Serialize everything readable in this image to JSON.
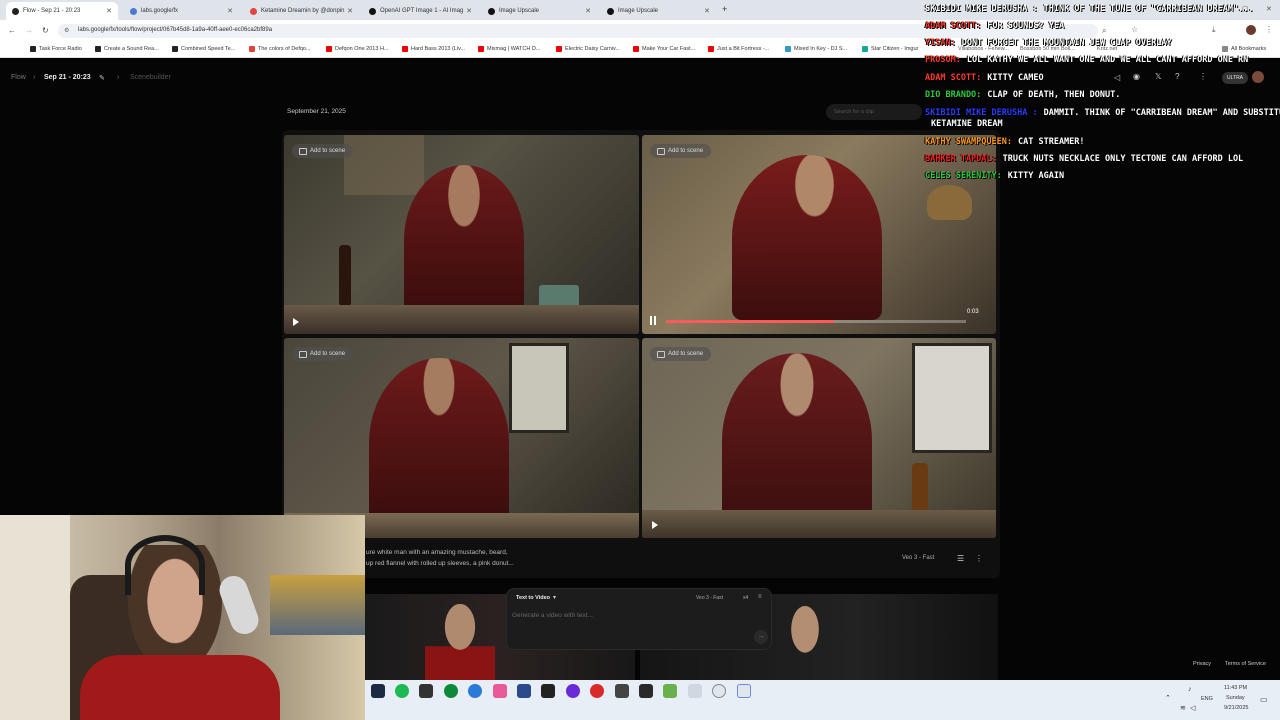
{
  "browser": {
    "tabs": [
      {
        "title": "Flow - Sep 21 - 20:23"
      },
      {
        "title": "labs.google/fx"
      },
      {
        "title": "Ketamine Dreamin by @donpin"
      },
      {
        "title": "OpenAI GPT Image 1 - AI Imag"
      },
      {
        "title": "Image Upscale"
      },
      {
        "title": "Image Upscale"
      }
    ],
    "new_tab": "+",
    "url": "labs.google/fx/tools/flow/project/067b45d8-1a9a-40ff-aee0-ec06ca2bf89a",
    "bookmarks": [
      {
        "label": "Task Force Radio",
        "color": "#222"
      },
      {
        "label": "Create a Sound Rea...",
        "color": "#222"
      },
      {
        "label": "Combined Speed Te...",
        "color": "#222"
      },
      {
        "label": "The colors of Defqo...",
        "color": "#e2443b"
      },
      {
        "label": "Defqon One 2013 H...",
        "color": "#e00"
      },
      {
        "label": "Hard Bass 2013 (Liv...",
        "color": "#e00"
      },
      {
        "label": "Mixmag | WATCH D...",
        "color": "#e00"
      },
      {
        "label": "Electric Daisy Carniv...",
        "color": "#e00"
      },
      {
        "label": "Make Your Car Fast...",
        "color": "#e00"
      },
      {
        "label": "Just a Bit Fortress -...",
        "color": "#e00"
      },
      {
        "label": "Mixed In Key - DJ S...",
        "color": "#39c"
      },
      {
        "label": "Star Citizen - Imgur",
        "color": "#1a9"
      }
    ],
    "all_bookmarks": "All Bookmarks",
    "overlay_bookmarks": [
      "Villabobos - Fehew...",
      "Bossbob 50 min Boll...",
      "Kritz.net"
    ]
  },
  "flow": {
    "crumb_root": "Flow",
    "crumb_project": "Sep 21 - 20:23",
    "crumb_scene": "Scenebuilder",
    "date_label": "September 21, 2025",
    "search_placeholder": "Search for a clip",
    "ultra_badge": "ULTRA",
    "add_to_scene": "Add to scene",
    "video_time": "0:03",
    "progress": 0.56,
    "prompt_line1": "ure white man with an amazing mustache, beard,",
    "prompt_line2": "up red flannel with rolled up sleeves, a pink donut...",
    "model_label": "Veo 3 - Fast",
    "composer": {
      "mode": "Text to Video",
      "model": "Veo 3 - Fast",
      "count": "x4",
      "placeholder": "Generate a video with text..."
    },
    "footer_privacy": "Privacy",
    "footer_terms": "Terms of Service"
  },
  "chat": [
    {
      "name": "Skibidi Mike DeRusha :",
      "color": "#ffffff",
      "msg": "Think of the tune of \"Carribean Dream\"..."
    },
    {
      "name": "Adam Scott:",
      "color": "#ff3b30",
      "msg": "For sounds? Yea"
    },
    {
      "name": "Yisan:",
      "color": "#ff3b30",
      "msg": "dont forget the mountain jew clap overlay"
    },
    {
      "name": "Frosom:",
      "color": "#ff3b30",
      "msg": "lol kathy we all want one and we all cant afford one rn"
    },
    {
      "name": "Adam Scott:",
      "color": "#ff3b30",
      "msg": "Kitty cameo"
    },
    {
      "name": "Dio Brando:",
      "color": "#2ecc40",
      "msg": "Clap of Death, then Donut."
    },
    {
      "name": "Skibidi Mike DeRusha :",
      "color": "#2b3cff",
      "msg": "Dammit. Think of \"Carribean Dream\" and substitute"
    },
    {
      "name": "",
      "color": "#ffffff",
      "msg": "Ketamine Dream"
    },
    {
      "name": "Kathy SwampQueen:",
      "color": "#ff9a1f",
      "msg": "cat streamer!"
    },
    {
      "name": "Bahker Tapdal:",
      "color": "#ff2020",
      "msg": "truck nuts necklace only tectone can afford lol"
    },
    {
      "name": "Celes Serenity:",
      "color": "#2ecc40",
      "msg": "Kitty again"
    }
  ],
  "taskbar": {
    "lang": "ENG",
    "time": "11:43 PM",
    "day": "Sunday",
    "date": "9/21/2025"
  }
}
